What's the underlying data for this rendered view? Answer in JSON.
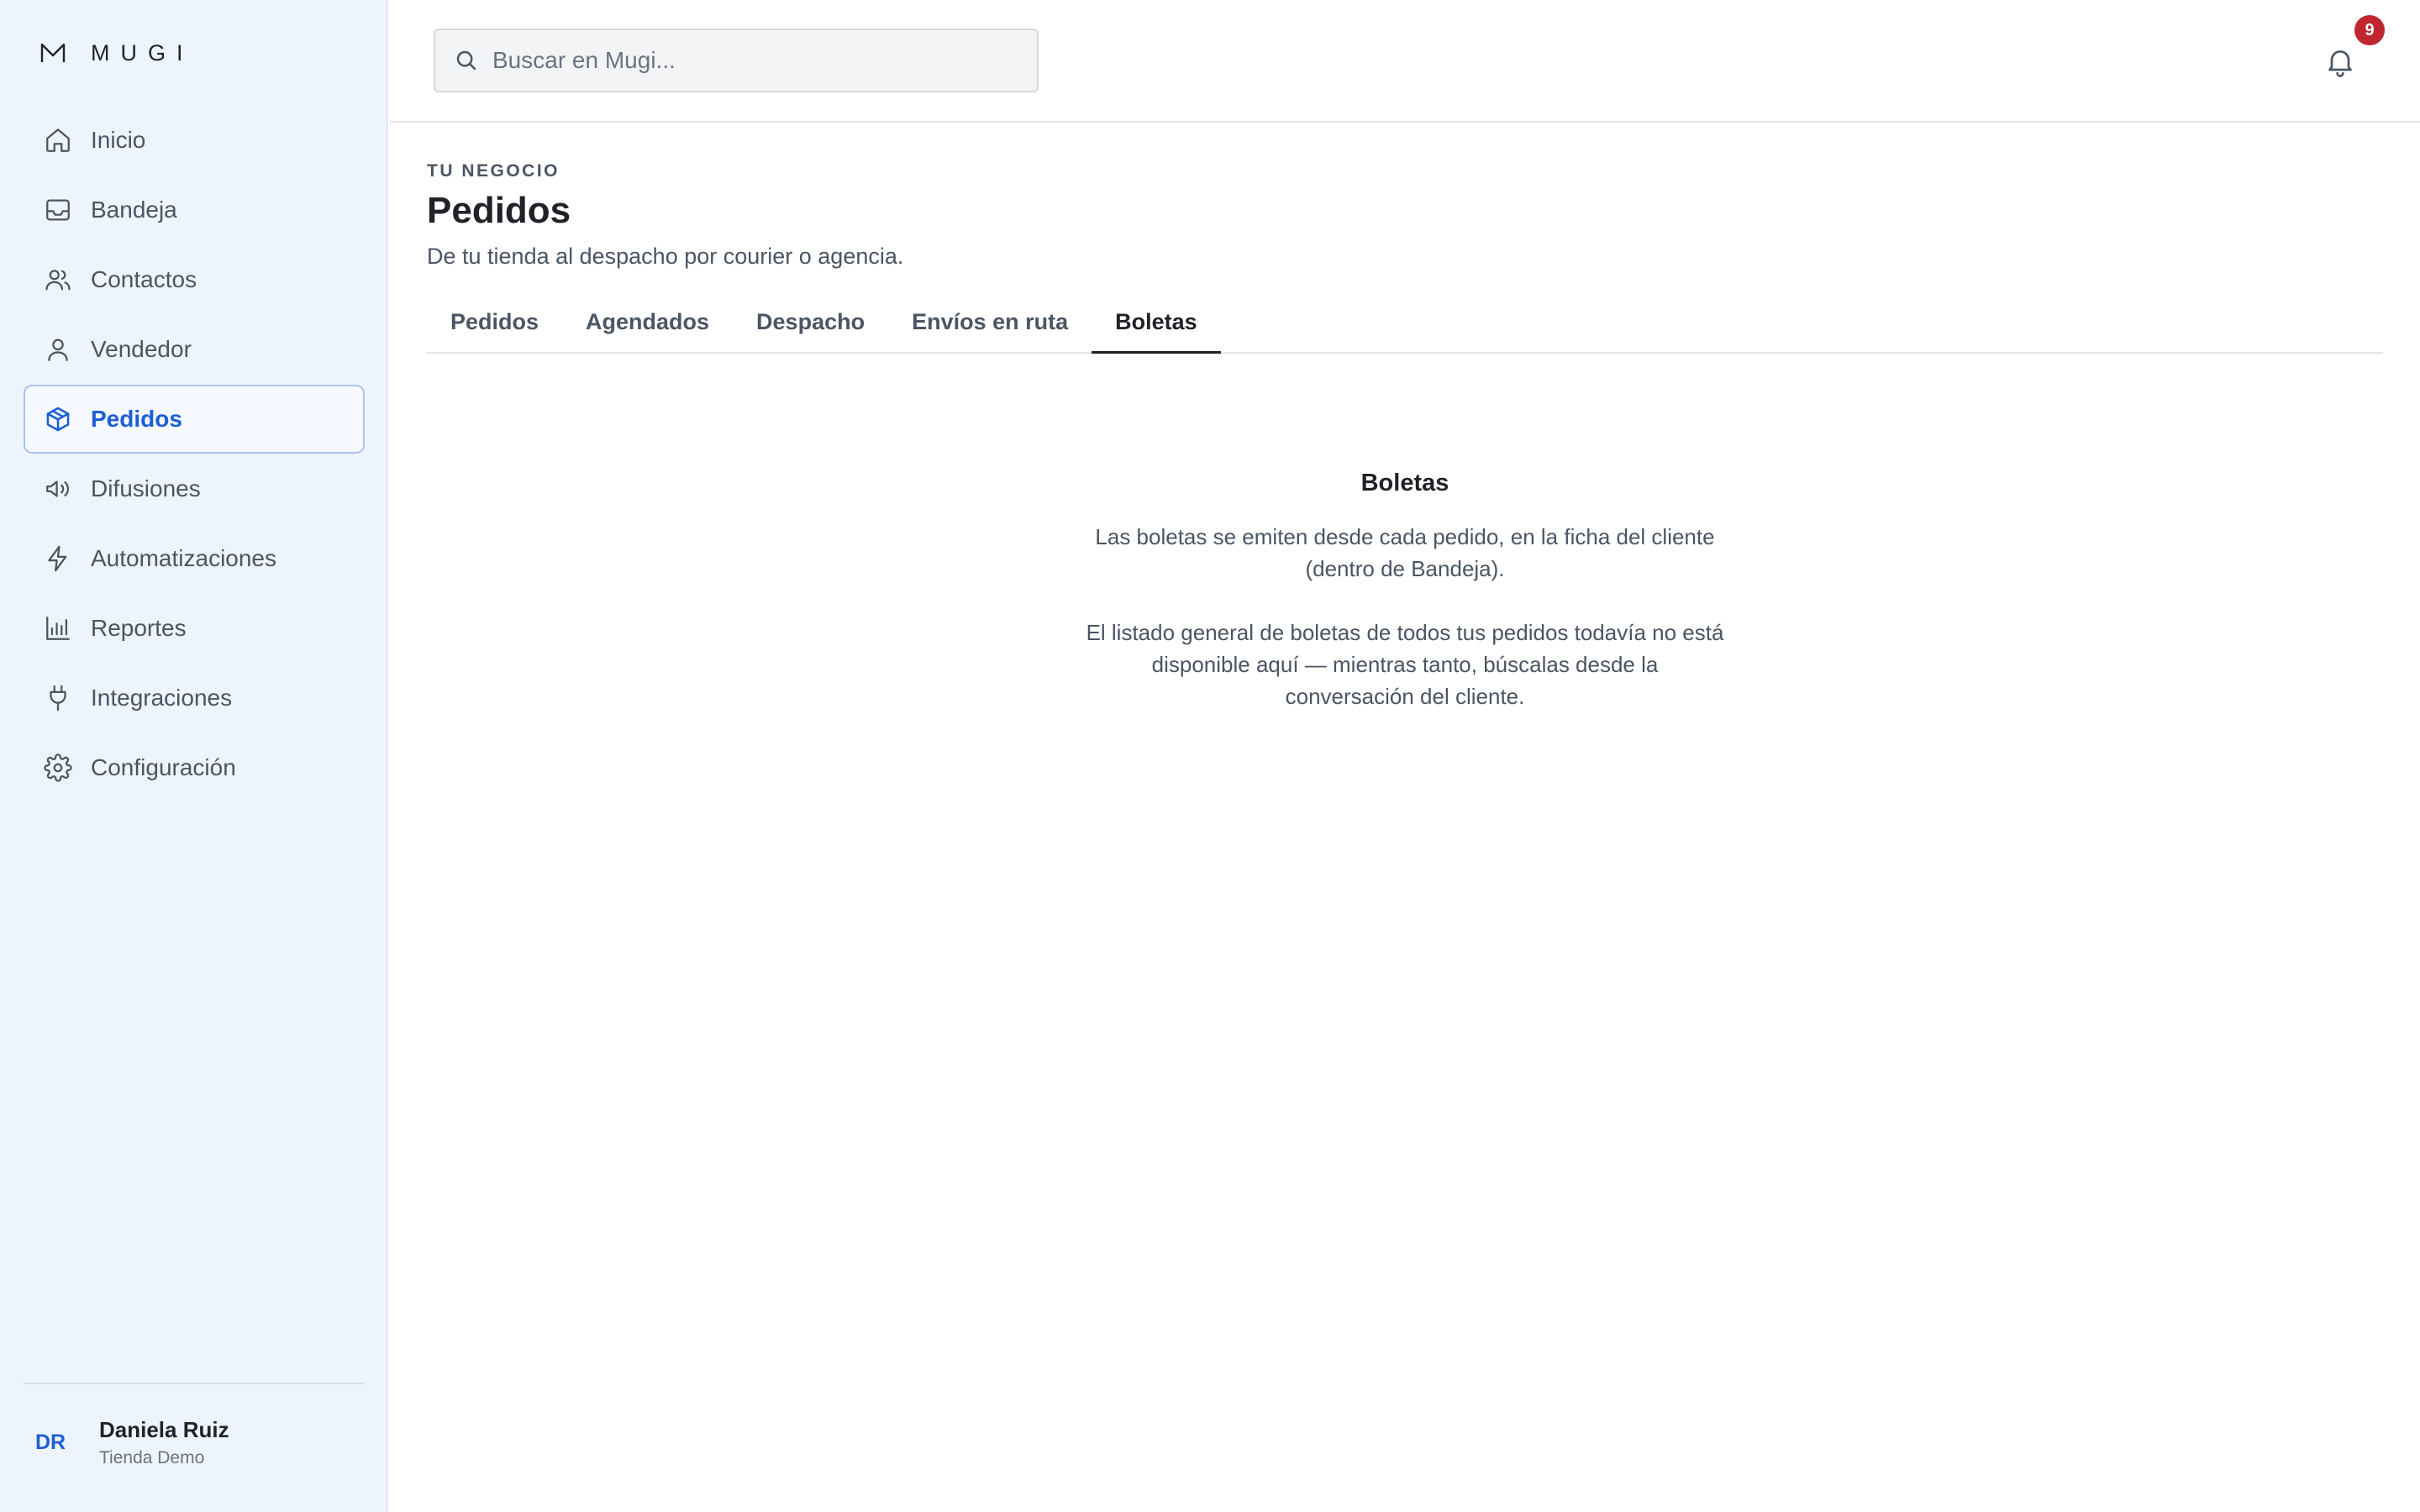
{
  "brand": {
    "name": "MUGI"
  },
  "sidebar": {
    "items": [
      {
        "label": "Inicio",
        "icon": "home-icon"
      },
      {
        "label": "Bandeja",
        "icon": "inbox-icon"
      },
      {
        "label": "Contactos",
        "icon": "users-icon"
      },
      {
        "label": "Vendedor",
        "icon": "user-icon"
      },
      {
        "label": "Pedidos",
        "icon": "box-icon",
        "active": true
      },
      {
        "label": "Difusiones",
        "icon": "megaphone-icon"
      },
      {
        "label": "Automatizaciones",
        "icon": "lightning-icon"
      },
      {
        "label": "Reportes",
        "icon": "bar-chart-icon"
      },
      {
        "label": "Integraciones",
        "icon": "plug-icon"
      },
      {
        "label": "Configuración",
        "icon": "gear-icon"
      }
    ],
    "user": {
      "initials": "DR",
      "name": "Daniela Ruiz",
      "store": "Tienda Demo"
    }
  },
  "topbar": {
    "search": {
      "placeholder": "Buscar en Mugi...",
      "value": ""
    },
    "notifications": {
      "count": "9"
    }
  },
  "page": {
    "eyebrow": "TU NEGOCIO",
    "title": "Pedidos",
    "subtitle": "De tu tienda al despacho por courier o agencia.",
    "tabs": [
      {
        "label": "Pedidos"
      },
      {
        "label": "Agendados"
      },
      {
        "label": "Despacho"
      },
      {
        "label": "Envíos en ruta"
      },
      {
        "label": "Boletas",
        "active": true
      }
    ],
    "empty": {
      "title": "Boletas",
      "text1": "Las boletas se emiten desde cada pedido, en la ficha del cliente (dentro de Bandeja).",
      "text2": "El listado general de boletas de todos tus pedidos todavía no está disponible aquí — mientras tanto, búscalas desde la conversación del cliente."
    }
  },
  "colors": {
    "accent": "#1d5fd6",
    "sidebar_bg": "#eef4fe",
    "badge": "#c0262e"
  }
}
